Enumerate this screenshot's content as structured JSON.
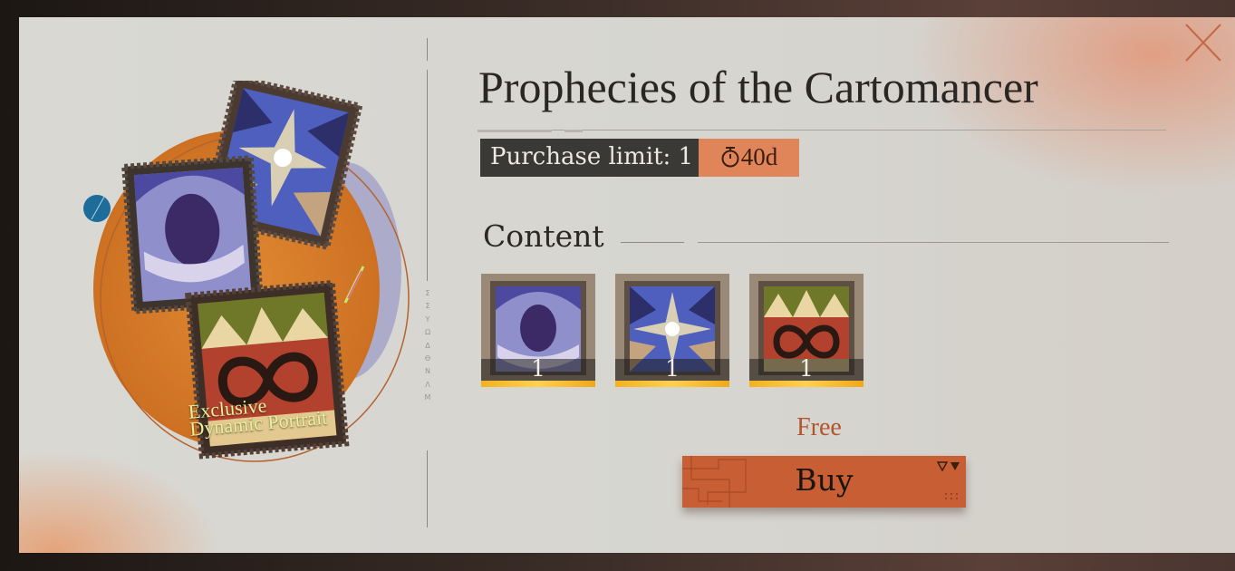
{
  "shop_item": {
    "title": "Prophecies of the Cartomancer",
    "purchase_limit": "Purchase limit: 1",
    "timer": "40d",
    "content_label": "Content",
    "price": "Free",
    "buy_label": "Buy",
    "portrait_label_line1": "Exclusive",
    "portrait_label_line2": "Dynamic Portrait",
    "side_caption": "ΣΣΥΩΔΘΝΛΜ",
    "contents": [
      {
        "name": "moon-card",
        "quantity": "1"
      },
      {
        "name": "star-card",
        "quantity": "1"
      },
      {
        "name": "infinity-card",
        "quantity": "1"
      }
    ]
  },
  "colors": {
    "accent": "#c75e34",
    "timer_tag": "#e0845a",
    "limit_tag": "#3b3936",
    "rarity_gold": "#f3b21e",
    "portrait_label": "#e8f09a"
  }
}
